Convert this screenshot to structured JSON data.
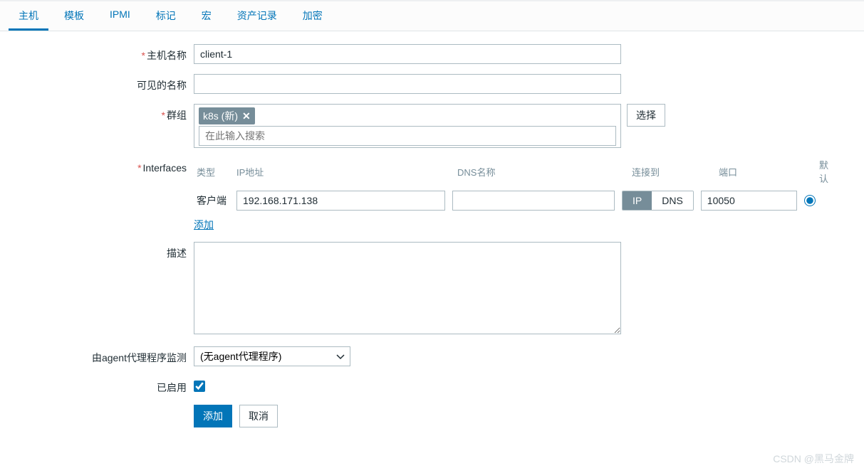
{
  "tabs": {
    "host": "主机",
    "template": "模板",
    "ipmi": "IPMI",
    "tag": "标记",
    "macro": "宏",
    "inventory": "资产记录",
    "encryption": "加密"
  },
  "labels": {
    "hostname": "主机名称",
    "visible_name": "可见的名称",
    "groups": "群组",
    "interfaces": "Interfaces",
    "description": "描述",
    "agent_proxy": "由agent代理程序监测",
    "enabled": "已启用"
  },
  "values": {
    "hostname": "client-1",
    "visible_name": "",
    "group_tag": "k8s (新)",
    "group_search_placeholder": "在此输入搜索",
    "btn_select": "选择",
    "description": "",
    "agent_proxy": "(无agent代理程序)",
    "enabled": true
  },
  "interfaces": {
    "headers": {
      "type": "类型",
      "ip": "IP地址",
      "dns": "DNS名称",
      "connect": "连接到",
      "port": "端口",
      "default": "默认"
    },
    "row": {
      "type": "客户端",
      "ip": "192.168.171.138",
      "dns": "",
      "connect_ip": "IP",
      "connect_dns": "DNS",
      "port": "10050"
    },
    "add_link": "添加"
  },
  "buttons": {
    "add": "添加",
    "cancel": "取消"
  },
  "watermark": "CSDN @黑马金牌"
}
